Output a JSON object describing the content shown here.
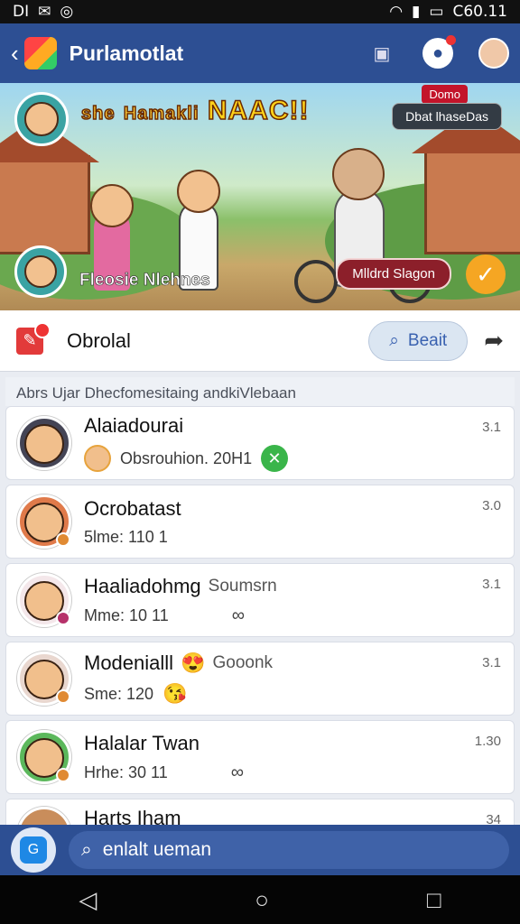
{
  "status_bar": {
    "left_text": "DI",
    "time": "C60.11"
  },
  "app_bar": {
    "title": "Purlamotlat"
  },
  "banner": {
    "title_small": "she",
    "title_mid": "Hamakli",
    "title_big": "NAAC!!",
    "top_badge": "Domo",
    "top_pill": "Dbat lhaseDas",
    "bottom_pill": "Mlldrd Slagon",
    "caption": "Fleosie Nlehnes"
  },
  "section": {
    "title": "Obrolal",
    "search_label": "Beait"
  },
  "subheader": "Abrs Ujar Dhecfomesitaing andkiVlebaan",
  "items": [
    {
      "name": "Alaiadourai",
      "extra": "",
      "sub": "Obsrouhion. 20H1",
      "time": "3.1",
      "color": "#444"
    },
    {
      "name": "Ocrobatast",
      "extra": "",
      "sub": "5lme: 110 1",
      "time": "3.0",
      "color": "#e07a4a"
    },
    {
      "name": "Haaliadohmg",
      "extra": "Soumsrn",
      "sub": "Mme: 10 11",
      "time": "3.1",
      "color": "#b6316a"
    },
    {
      "name": "Modenialll",
      "extra": "Gooonk",
      "sub": "Sme: 120",
      "time": "3.1",
      "color": "#e08a33"
    },
    {
      "name": "Halalar Twan",
      "extra": "",
      "sub": "Hrhe: 30 11",
      "time": "1.30",
      "color": "#e08a33"
    },
    {
      "name": "Harts Iham",
      "extra": "",
      "sub": "",
      "time": "34",
      "color": "#e08a33"
    }
  ],
  "bottom_search": {
    "text": "enlalt ueman"
  },
  "icons": {
    "back": "chevron-left-icon",
    "monitor": "monitor-icon",
    "chat": "chat-icon",
    "search": "search-icon",
    "share": "share-icon",
    "home": "home-icon"
  }
}
